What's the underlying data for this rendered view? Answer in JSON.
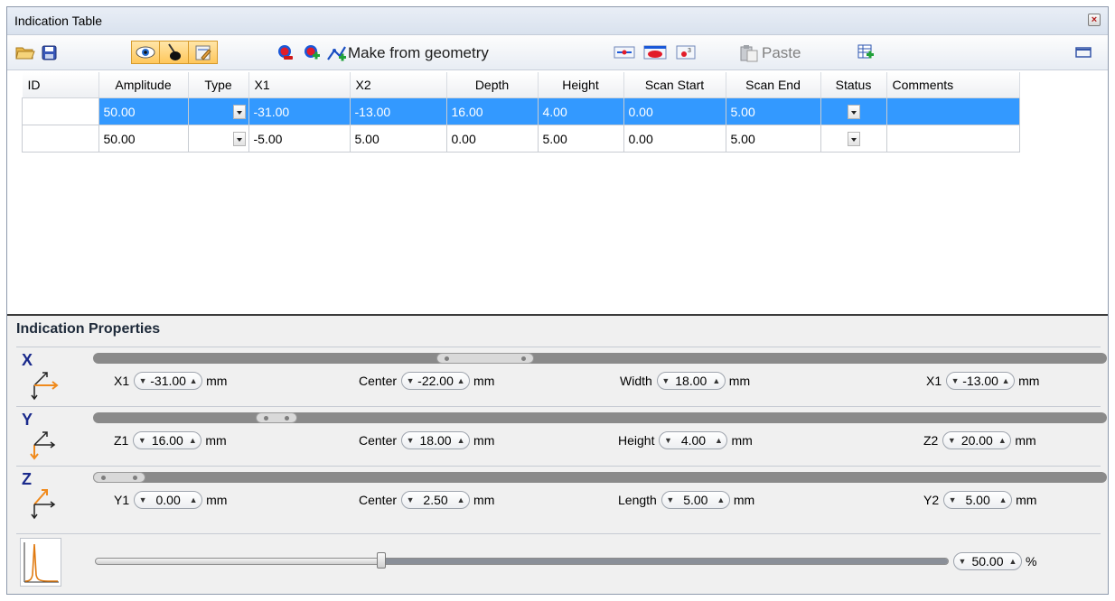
{
  "window": {
    "title": "Indication Table"
  },
  "toolbar": {
    "make_from_geometry": "Make from geometry",
    "paste": "Paste"
  },
  "grid": {
    "columns": [
      "ID",
      "Amplitude",
      "Type",
      "X1",
      "X2",
      "Depth",
      "Height",
      "Scan Start",
      "Scan End",
      "Status",
      "Comments"
    ],
    "rows": [
      {
        "id": "",
        "amplitude": "50.00",
        "type": "",
        "x1": "-31.00",
        "x2": "-13.00",
        "depth": "16.00",
        "height": "4.00",
        "scan_start": "0.00",
        "scan_end": "5.00",
        "status": "",
        "comments": "",
        "selected": true
      },
      {
        "id": "",
        "amplitude": "50.00",
        "type": "",
        "x1": "-5.00",
        "x2": "5.00",
        "depth": "0.00",
        "height": "5.00",
        "scan_start": "0.00",
        "scan_end": "5.00",
        "status": "",
        "comments": "",
        "selected": false
      }
    ]
  },
  "properties": {
    "title": "Indication Properties",
    "x": {
      "axis": "X",
      "f1_label": "X1",
      "f1_value": "-31.00",
      "f2_label": "Center",
      "f2_value": "-22.00",
      "f3_label": "Width",
      "f3_value": "18.00",
      "f4_label": "X1",
      "f4_value": "-13.00",
      "unit": "mm"
    },
    "y": {
      "axis": "Y",
      "f1_label": "Z1",
      "f1_value": "16.00",
      "f2_label": "Center",
      "f2_value": "18.00",
      "f3_label": "Height",
      "f3_value": "4.00",
      "f4_label": "Z2",
      "f4_value": "20.00",
      "unit": "mm"
    },
    "z": {
      "axis": "Z",
      "f1_label": "Y1",
      "f1_value": "0.00",
      "f2_label": "Center",
      "f2_value": "2.50",
      "f3_label": "Length",
      "f3_value": "5.00",
      "f4_label": "Y2",
      "f4_value": "5.00",
      "unit": "mm"
    },
    "amplitude": {
      "value": "50.00",
      "unit": "%"
    }
  },
  "colors": {
    "selection": "#3399ff",
    "axis_x": "#1a2a8c",
    "axis_arrow": "#f08a1c"
  },
  "icons": [
    "open-folder-icon",
    "save-icon",
    "eye-icon",
    "probe-icon",
    "edit-icon",
    "remove-indication-icon",
    "add-indication-icon",
    "make-from-geometry-icon",
    "view-icon-1",
    "view-icon-2",
    "view-icon-3",
    "paste-icon",
    "export-table-icon",
    "maximize-icon",
    "close-icon"
  ]
}
